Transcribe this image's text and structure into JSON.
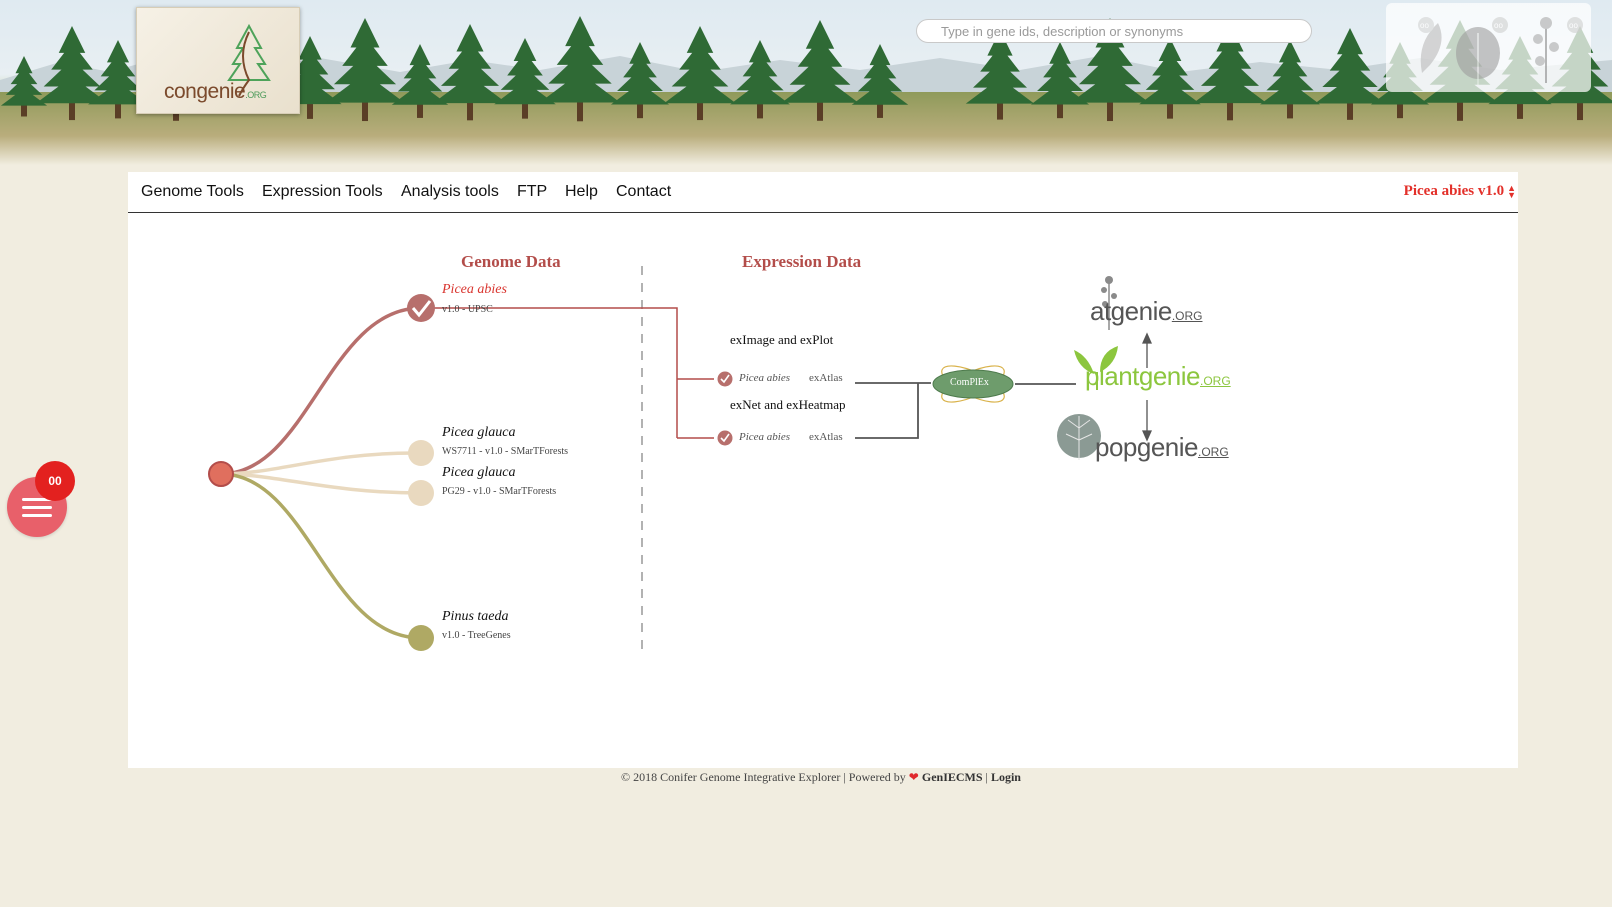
{
  "site": {
    "logo_text": "congenie",
    "logo_suffix": ".ORG"
  },
  "search": {
    "placeholder": "Type in gene ids, description or synonyms",
    "value": ""
  },
  "nav": {
    "items": [
      "Genome Tools",
      "Expression Tools",
      "Analysis tools",
      "FTP",
      "Help",
      "Contact"
    ],
    "selected_genome": "Picea abies v1.0"
  },
  "diagram": {
    "genome_title": "Genome Data",
    "expression_title": "Expression Data",
    "genomes": [
      {
        "species": "Picea abies",
        "version": "v1.0 - UPSC",
        "color": "#b76f6c",
        "selected": true
      },
      {
        "species": "Picea glauca",
        "version": "WS7711 - v1.0 - SMarTForests",
        "color": "#e9d9bf",
        "selected": false
      },
      {
        "species": "Picea glauca",
        "version": "PG29 - v1.0 - SMarTForests",
        "color": "#e9d9bf",
        "selected": false
      },
      {
        "species": "Pinus taeda",
        "version": "v1.0 - TreeGenes",
        "color": "#afa964",
        "selected": false
      }
    ],
    "root_color": "#e06f5e",
    "tools": [
      {
        "title": "exImage and exPlot",
        "species": "Picea abies",
        "link": "exAtlas"
      },
      {
        "title": "exNet and exHeatmap",
        "species": "Picea abies",
        "link": "exAtlas"
      }
    ],
    "complex_label": "ComPlEx",
    "genies": [
      {
        "name": "atgenie",
        "org": ".ORG",
        "color": "#555555"
      },
      {
        "name": "plantgenie",
        "org": ".ORG",
        "color": "#8cc63e"
      },
      {
        "name": "popgenie",
        "org": ".ORG",
        "color": "#555555"
      }
    ]
  },
  "fab": {
    "badge": "00"
  },
  "footer": {
    "copyright": "© 2018 Conifer Genome Integrative Explorer | Powered by",
    "heart": "❤",
    "cms": "GenIECMS",
    "separator": "|",
    "login": "Login"
  }
}
